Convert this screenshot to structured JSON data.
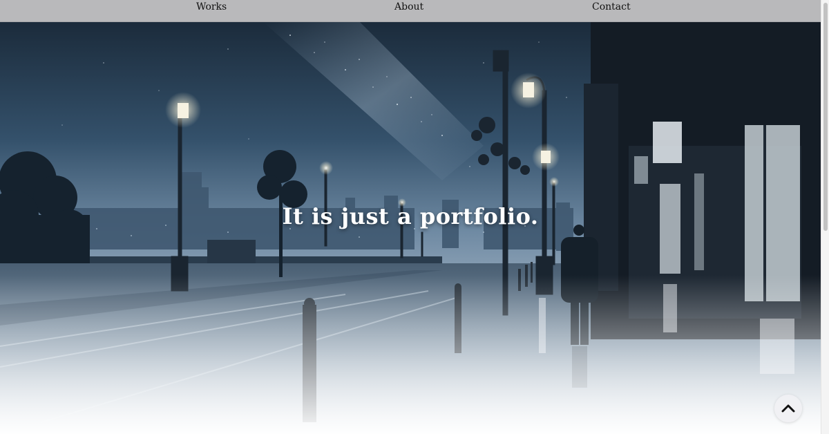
{
  "nav": {
    "items": [
      {
        "label": "Works"
      },
      {
        "label": "About"
      },
      {
        "label": "Contact"
      }
    ]
  },
  "hero": {
    "title": "It is just a portfolio."
  },
  "back_to_top": {
    "icon": "chevron-up-icon"
  },
  "colors": {
    "nav_bg": "#b9b9bb",
    "sky_top": "#1c2d3d",
    "sky_horizon": "#6f8aa3"
  }
}
